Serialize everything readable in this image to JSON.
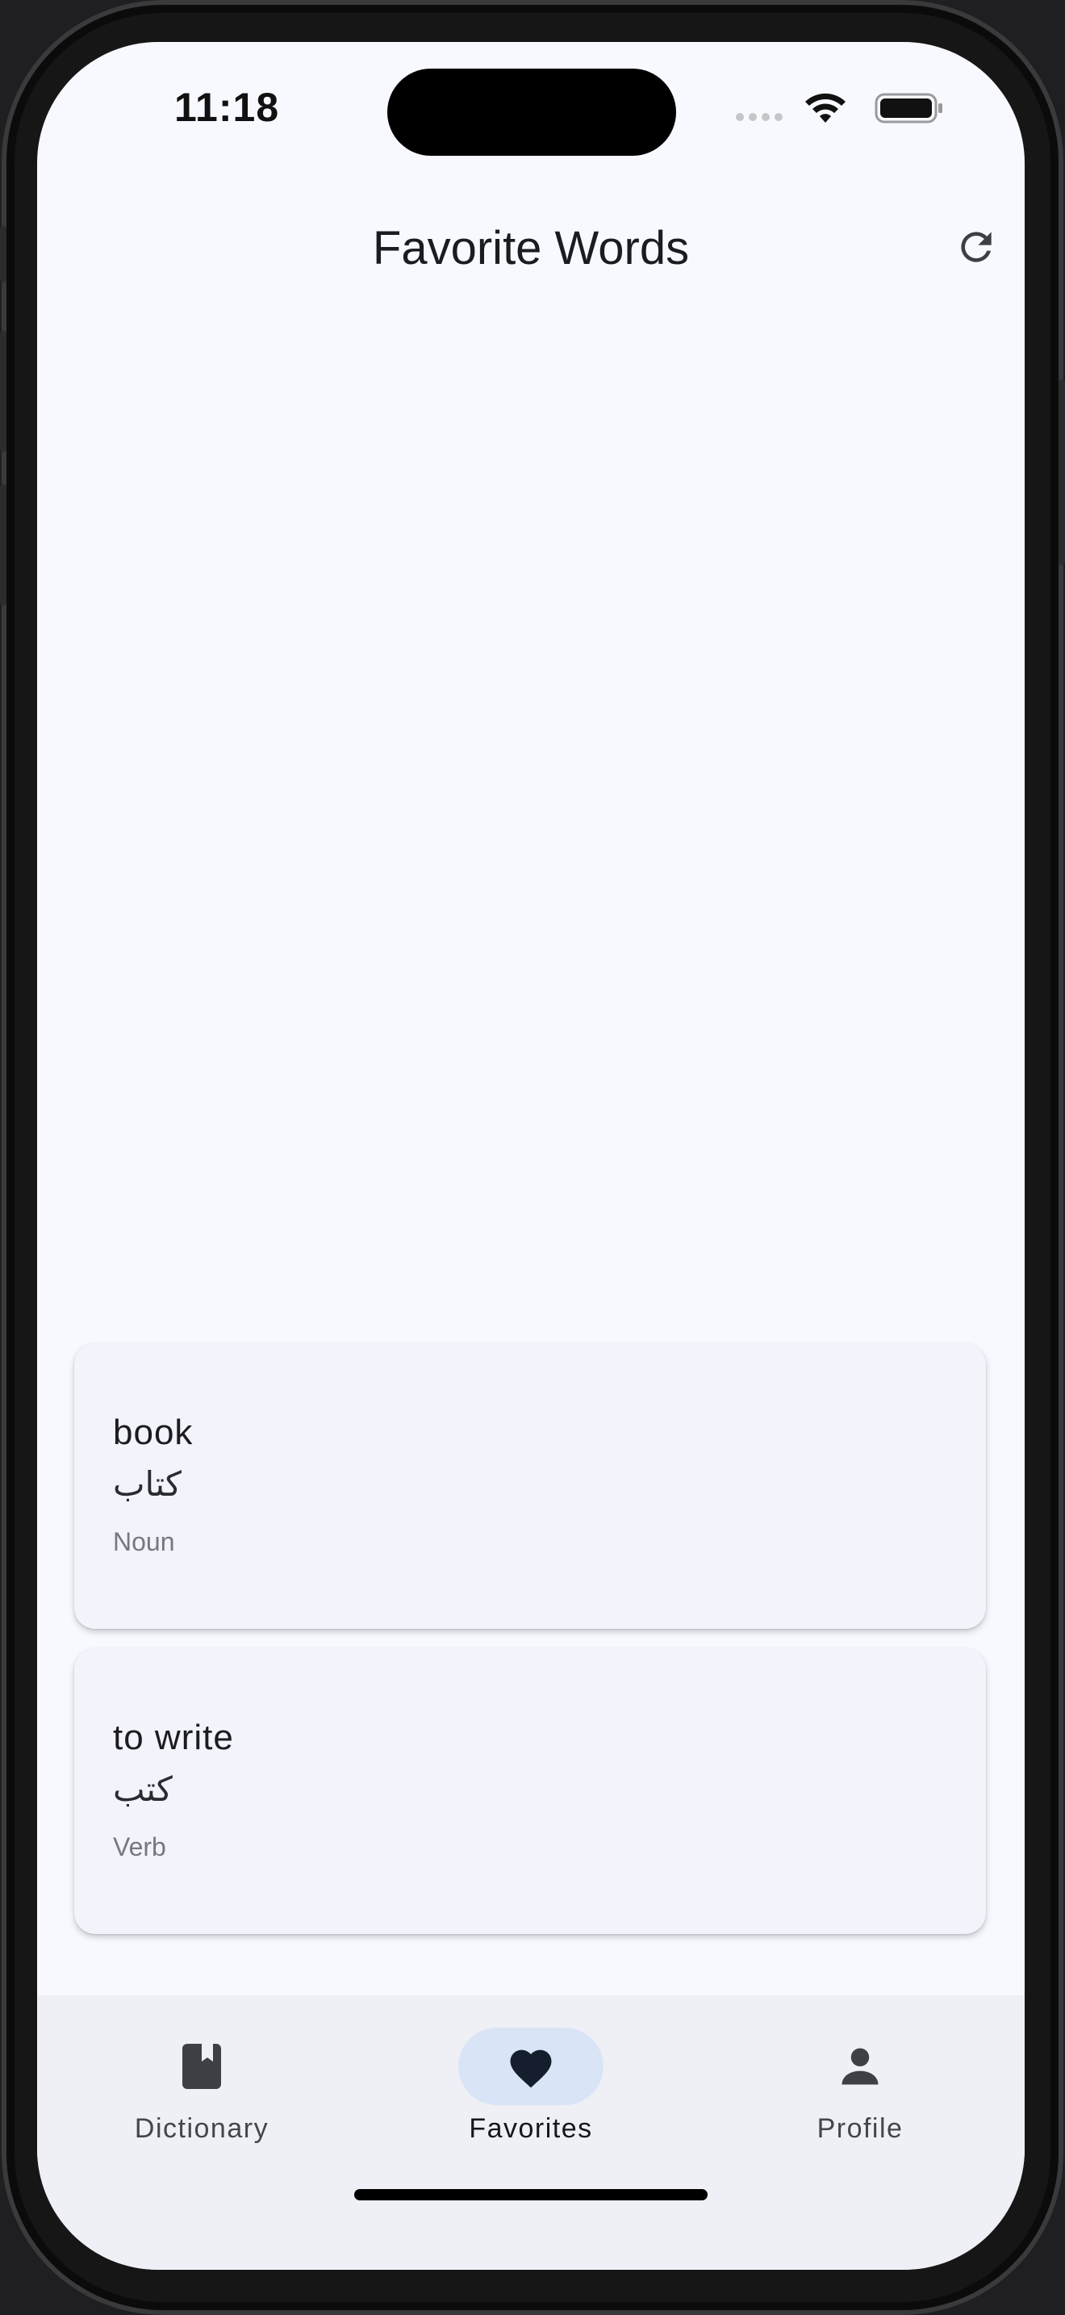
{
  "status_bar": {
    "time": "11:18"
  },
  "app_bar": {
    "title": "Favorite Words",
    "refresh_icon": "refresh-icon"
  },
  "favorites": [
    {
      "word": "book",
      "translation": "كتاب",
      "part_of_speech": "Noun"
    },
    {
      "word": "to write",
      "translation": "كتب",
      "part_of_speech": "Verb"
    }
  ],
  "bottom_nav": {
    "items": [
      {
        "label": "Dictionary",
        "icon": "book-icon",
        "active": false
      },
      {
        "label": "Favorites",
        "icon": "heart-icon",
        "active": true
      },
      {
        "label": "Profile",
        "icon": "person-icon",
        "active": false
      }
    ]
  },
  "colors": {
    "background": "#f8f9fe",
    "card": "#f2f3fb",
    "nav_bar": "#eef0f5",
    "active_pill": "#d9e5f7"
  }
}
